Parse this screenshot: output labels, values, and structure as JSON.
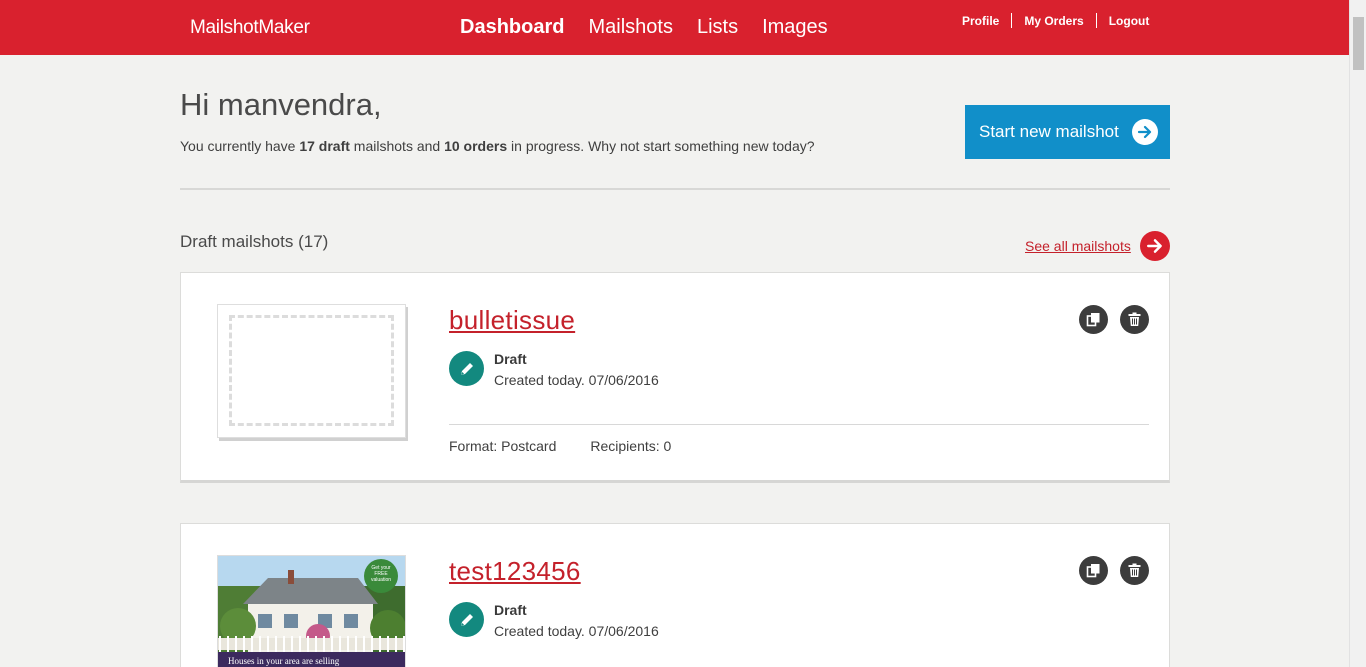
{
  "header": {
    "brand": "MailshotMaker",
    "nav": [
      "Dashboard",
      "Mailshots",
      "Lists",
      "Images"
    ],
    "user_nav": [
      "Profile",
      "My Orders",
      "Logout"
    ]
  },
  "greeting": {
    "title": "Hi manvendra,",
    "summary_pre": "You currently have ",
    "draft_count": "17 draft",
    "summary_mid": " mailshots and ",
    "order_count": "10 orders",
    "summary_post": " in progress. Why not start something new today?"
  },
  "start_button": "Start new mailshot",
  "drafts": {
    "section_title": "Draft mailshots (17)",
    "see_all": "See all mailshots",
    "items": [
      {
        "title": "bulletissue",
        "status": "Draft",
        "created": "Created today. 07/06/2016",
        "format": "Format: Postcard",
        "recipients": "Recipients: 0"
      },
      {
        "title": "test123456",
        "status": "Draft",
        "created": "Created today. 07/06/2016",
        "thumb_badge": [
          "Get your",
          "FREE",
          "valuation"
        ],
        "thumb_caption": "Houses in your area are selling"
      }
    ]
  },
  "colors": {
    "brand_red": "#d9212e",
    "button_blue": "#118fc9",
    "status_teal": "#13897f"
  },
  "icons": [
    "arrow-right-icon",
    "pencil-icon",
    "copy-icon",
    "trash-icon"
  ]
}
